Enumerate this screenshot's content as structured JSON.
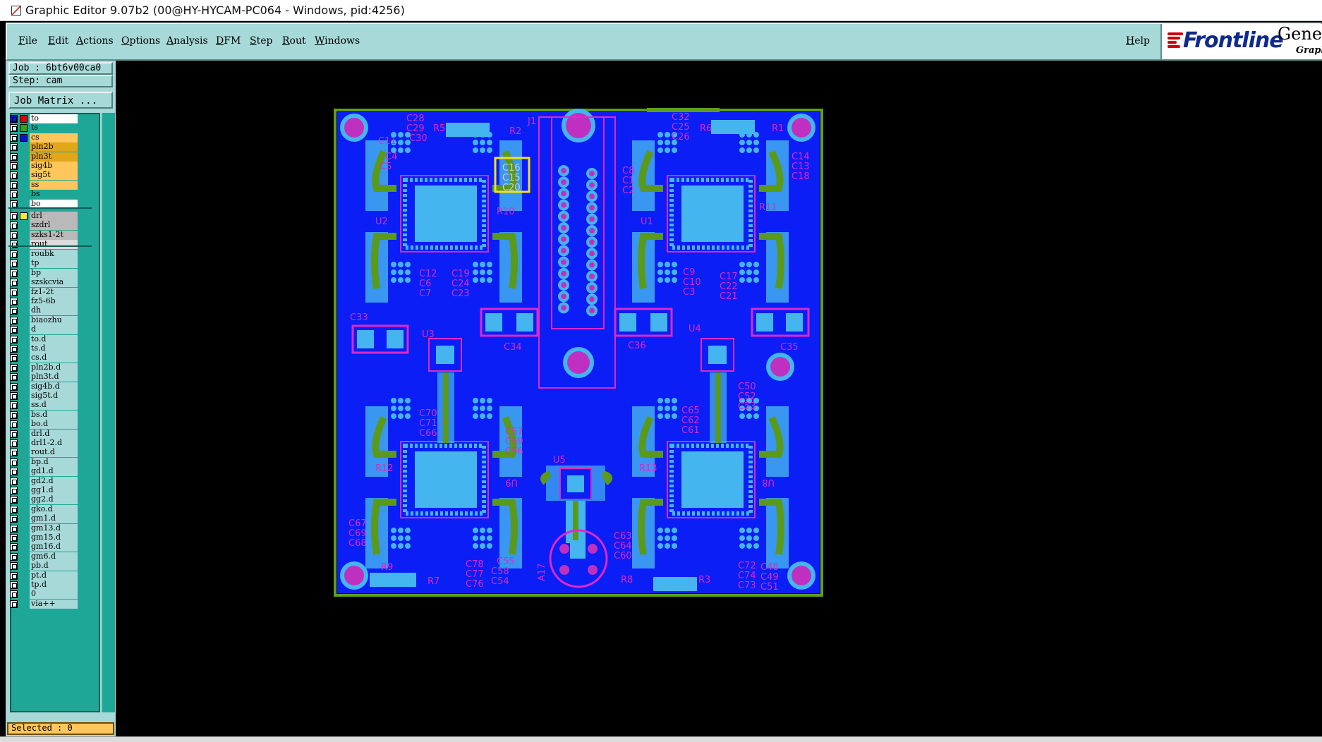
{
  "window": {
    "title": "Graphic Editor 9.07b2 (00@HY-HYCAM-PC064 - Windows, pid:4256)"
  },
  "menu": {
    "file": {
      "first": "F",
      "rest": "ile"
    },
    "edit": {
      "first": "E",
      "rest": "dit"
    },
    "actions": {
      "first": "A",
      "rest": "ctions"
    },
    "options": {
      "first": "O",
      "rest": "ptions"
    },
    "analysis": {
      "first": "A",
      "rest": "nalysis"
    },
    "dfm": {
      "first": "D",
      "rest": "FM"
    },
    "step": {
      "first": "S",
      "rest": "tep"
    },
    "rout": {
      "first": "R",
      "rest": "out"
    },
    "windows": {
      "first": "W",
      "rest": "indows"
    },
    "help": {
      "first": "H",
      "rest": "elp"
    }
  },
  "logo": {
    "brand": "Frontline",
    "product": "Genes",
    "subtitle": "Graph"
  },
  "job": {
    "label": "Job : 6bt6v00ca0",
    "step": "Step: cam",
    "matrix_button": "Job Matrix ..."
  },
  "colors": {
    "board": "#0a1ef5",
    "pad": "#45b5f0",
    "trace": "#5a9a1a",
    "silk": "#e028c8",
    "outline": "#5f9e1c",
    "panel": "#a6d9d8",
    "layer_list": "#1ea797",
    "selection_box": "#f0e020"
  },
  "layers": {
    "board": [
      {
        "name": "to",
        "color": "#ffffff",
        "swatch": "#e00000",
        "box": "#1010d0"
      },
      {
        "name": "ts",
        "color": "#1ea797",
        "swatch": "#37a020"
      },
      {
        "name": "cs",
        "color": "#ffc65b",
        "swatch": "#1010d0"
      },
      {
        "name": "pln2b",
        "color": "#e2a619"
      },
      {
        "name": "pln3t",
        "color": "#e2a619"
      },
      {
        "name": "sig4b",
        "color": "#ffc65b"
      },
      {
        "name": "sig5t",
        "color": "#ffc65b"
      },
      {
        "name": "ss",
        "color": "#ffc65b"
      },
      {
        "name": "bs",
        "color": "#1ea797"
      },
      {
        "name": "bo",
        "color": "#ffffff"
      }
    ],
    "drill": [
      {
        "name": "drl",
        "color": "#b9b9b9",
        "swatch": "#ffe92e"
      },
      {
        "name": "szdrl",
        "color": "#b9b9b9"
      },
      {
        "name": "szks1-2t",
        "color": "#b9b9b9"
      },
      {
        "name": "rout",
        "color": "#dcdcdc"
      }
    ],
    "misc": [
      {
        "name": "roubk"
      },
      {
        "name": "tp"
      },
      {
        "name": "bp"
      },
      {
        "name": "szskcvia"
      },
      {
        "name": "fz1-2t"
      },
      {
        "name": "fz5-6b"
      },
      {
        "name": "dh"
      },
      {
        "name": "biaozhu"
      },
      {
        "name": "d"
      },
      {
        "name": "to.d"
      },
      {
        "name": "ts.d"
      },
      {
        "name": "cs.d"
      },
      {
        "name": "pln2b.d"
      },
      {
        "name": "pln3t.d"
      },
      {
        "name": "sig4b.d"
      },
      {
        "name": "sig5t.d"
      },
      {
        "name": "ss.d"
      },
      {
        "name": "bs.d"
      },
      {
        "name": "bo.d"
      },
      {
        "name": "drl.d"
      },
      {
        "name": "drl1-2.d"
      },
      {
        "name": "rout.d"
      },
      {
        "name": "bp.d"
      },
      {
        "name": "gd1.d"
      },
      {
        "name": "gd2.d"
      },
      {
        "name": "gg1.d"
      },
      {
        "name": "gg2.d"
      },
      {
        "name": "gko.d"
      },
      {
        "name": "gm1.d"
      },
      {
        "name": "gm13.d"
      },
      {
        "name": "gm15.d"
      },
      {
        "name": "gm16.d"
      },
      {
        "name": "gm6.d"
      },
      {
        "name": "pb.d"
      },
      {
        "name": "pt.d"
      },
      {
        "name": "tp.d"
      },
      {
        "name": "0"
      },
      {
        "name": "via++"
      }
    ]
  },
  "selected": "Selected : 0",
  "pcb": {
    "refs": {
      "c28": "C28",
      "c29": "C29",
      "c30": "C30",
      "r5": "R5",
      "r2": "R2",
      "j1": "J1",
      "c32": "C32",
      "c25": "C25",
      "c26": "C26",
      "r6": "R6",
      "r1": "R1",
      "c11": "C11",
      "c4": "C4",
      "c5": "C5",
      "c14": "C14",
      "c13": "C13",
      "c18": "C18",
      "c16": "C16",
      "c15": "C15",
      "c20": "C20",
      "c8": "C8",
      "c1": "C1",
      "c2": "C2",
      "r10": "R10",
      "r11": "R11",
      "u2": "U2",
      "u1": "U1",
      "c12": "C12",
      "c6": "C6",
      "c7": "C7",
      "c19": "C19",
      "c24": "C24",
      "c23": "C23",
      "c9": "C9",
      "c10": "C10",
      "c3": "C3",
      "c17": "C17",
      "c22": "C22",
      "c21": "C21",
      "c33": "C33",
      "c34": "C34",
      "c36": "C36",
      "c35": "C35",
      "u3": "U3",
      "u4": "U4",
      "c50": "C50",
      "c52": "C52",
      "c53": "C53",
      "c70": "C70",
      "c71": "C71",
      "c66": "C66",
      "c57": "C57",
      "c59": "C59",
      "c56": "C56",
      "c65": "C65",
      "c62": "C62",
      "c61": "C61",
      "u5": "U5",
      "r12": "R12",
      "r13": "R13",
      "u9": "U9",
      "u8": "U8",
      "c67": "C67",
      "c69": "C69",
      "c68": "C68",
      "c63": "C63",
      "c64": "C64",
      "c60": "C60",
      "a17": "A17",
      "r9": "R9",
      "r7": "R7",
      "c78": "C78",
      "c77": "C77",
      "c76": "C76",
      "c55": "C55",
      "c58": "C58",
      "c54": "C54",
      "r8": "R8",
      "r3": "R3",
      "c72": "C72",
      "c74": "C74",
      "c73": "C73",
      "c48": "C48",
      "c49": "C49",
      "c51": "C51"
    }
  }
}
